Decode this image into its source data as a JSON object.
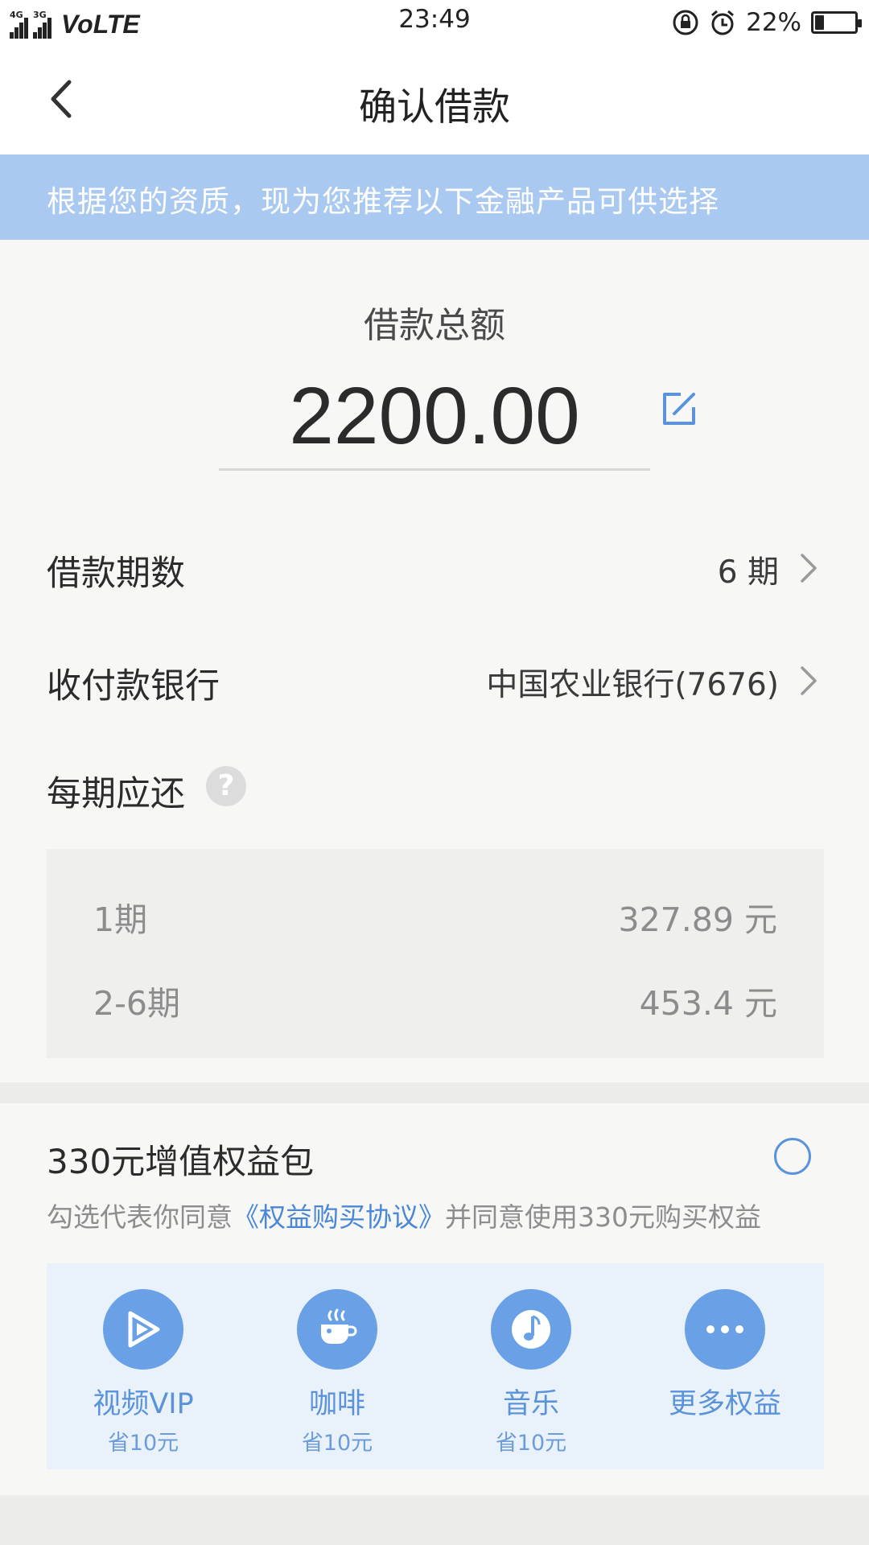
{
  "status_bar": {
    "network_1": "4G",
    "network_2": "3G",
    "volte": "VoLTE",
    "time": "23:49",
    "battery_percent": "22%",
    "battery_level": 0.22,
    "icons": [
      "lock-rotation-icon",
      "alarm-icon",
      "battery-icon"
    ]
  },
  "nav": {
    "title": "确认借款",
    "back_icon": "chevron-left-icon"
  },
  "banner": {
    "text": "根据您的资质，现为您推荐以下金融产品可供选择"
  },
  "amount": {
    "label": "借款总额",
    "value": "2200.00",
    "edit_icon": "edit-icon"
  },
  "term": {
    "label": "借款期数",
    "value": "6 期"
  },
  "bank": {
    "label": "收付款银行",
    "value": "中国农业银行(7676)"
  },
  "repayment": {
    "label": "每期应还",
    "help_icon": "?",
    "schedule": [
      {
        "period": "1期",
        "amount": "327.89 元"
      },
      {
        "period": "2-6期",
        "amount": "453.4 元"
      }
    ]
  },
  "benefit": {
    "title": "330元增值权益包",
    "checked": false,
    "agree_prefix": "勾选代表你同意",
    "agree_link": "《权益购买协议》",
    "agree_suffix": "并同意使用330元购买权益",
    "items": [
      {
        "name": "视频VIP",
        "save": "省10元",
        "icon": "video-play-icon"
      },
      {
        "name": "咖啡",
        "save": "省10元",
        "icon": "coffee-cup-icon"
      },
      {
        "name": "音乐",
        "save": "省10元",
        "icon": "music-note-icon"
      },
      {
        "name": "更多权益",
        "save": "",
        "icon": "more-dots-icon"
      }
    ]
  },
  "colors": {
    "accent": "#5b93db",
    "banner_bg": "#a9c9f0",
    "benefit_bg": "#e9f1fb"
  }
}
